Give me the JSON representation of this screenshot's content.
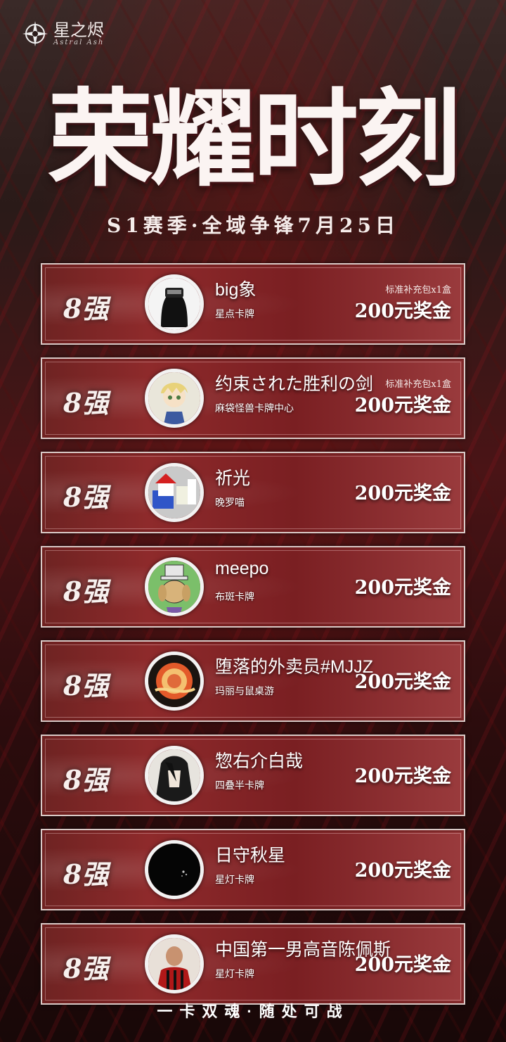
{
  "brand": {
    "name_cn": "星之烬",
    "name_en": "Astral Ash"
  },
  "title": "荣耀时刻",
  "subtitle": "S1赛季·全域争锋7月25日",
  "entries": [
    {
      "rank": "8强",
      "name": "big象",
      "club": "星点卡牌",
      "pack": "标准补充包x1盒",
      "prize": "200元奖金",
      "avatar": "dark-hooded-figure-avatar"
    },
    {
      "rank": "8强",
      "name": "约束された胜利の剑",
      "club": "麻袋怪兽卡牌中心",
      "pack": "标准补充包x1盒",
      "prize": "200元奖金",
      "avatar": "anime-knight-avatar"
    },
    {
      "rank": "8强",
      "name": "祈光",
      "club": "晚罗喵",
      "pack": "",
      "prize": "200元奖金",
      "avatar": "pixel-building-avatar"
    },
    {
      "rank": "8强",
      "name": "meepo",
      "club": "布斑卡牌",
      "pack": "",
      "prize": "200元奖金",
      "avatar": "cartoon-dog-tophat-avatar"
    },
    {
      "rank": "8强",
      "name": "堕落的外卖员#MJJZ",
      "club": "玛丽与鼠桌游",
      "pack": "",
      "prize": "200元奖金",
      "avatar": "swirl-emblem-avatar"
    },
    {
      "rank": "8强",
      "name": "惣右介白哉",
      "club": "四叠半卡牌",
      "pack": "",
      "prize": "200元奖金",
      "avatar": "dark-haired-character-avatar"
    },
    {
      "rank": "8强",
      "name": "日守秋星",
      "club": "星灯卡牌",
      "pack": "",
      "prize": "200元奖金",
      "avatar": "black-night-avatar"
    },
    {
      "rank": "8强",
      "name": "中国第一男高音陈佩斯",
      "club": "星灯卡牌",
      "pack": "",
      "prize": "200元奖金",
      "avatar": "football-player-avatar"
    }
  ],
  "footer": "一卡双魂·随处可战",
  "colors": {
    "accent_red": "#8e2a2b",
    "frame": "#d9c9c6",
    "text": "#ffffff"
  }
}
